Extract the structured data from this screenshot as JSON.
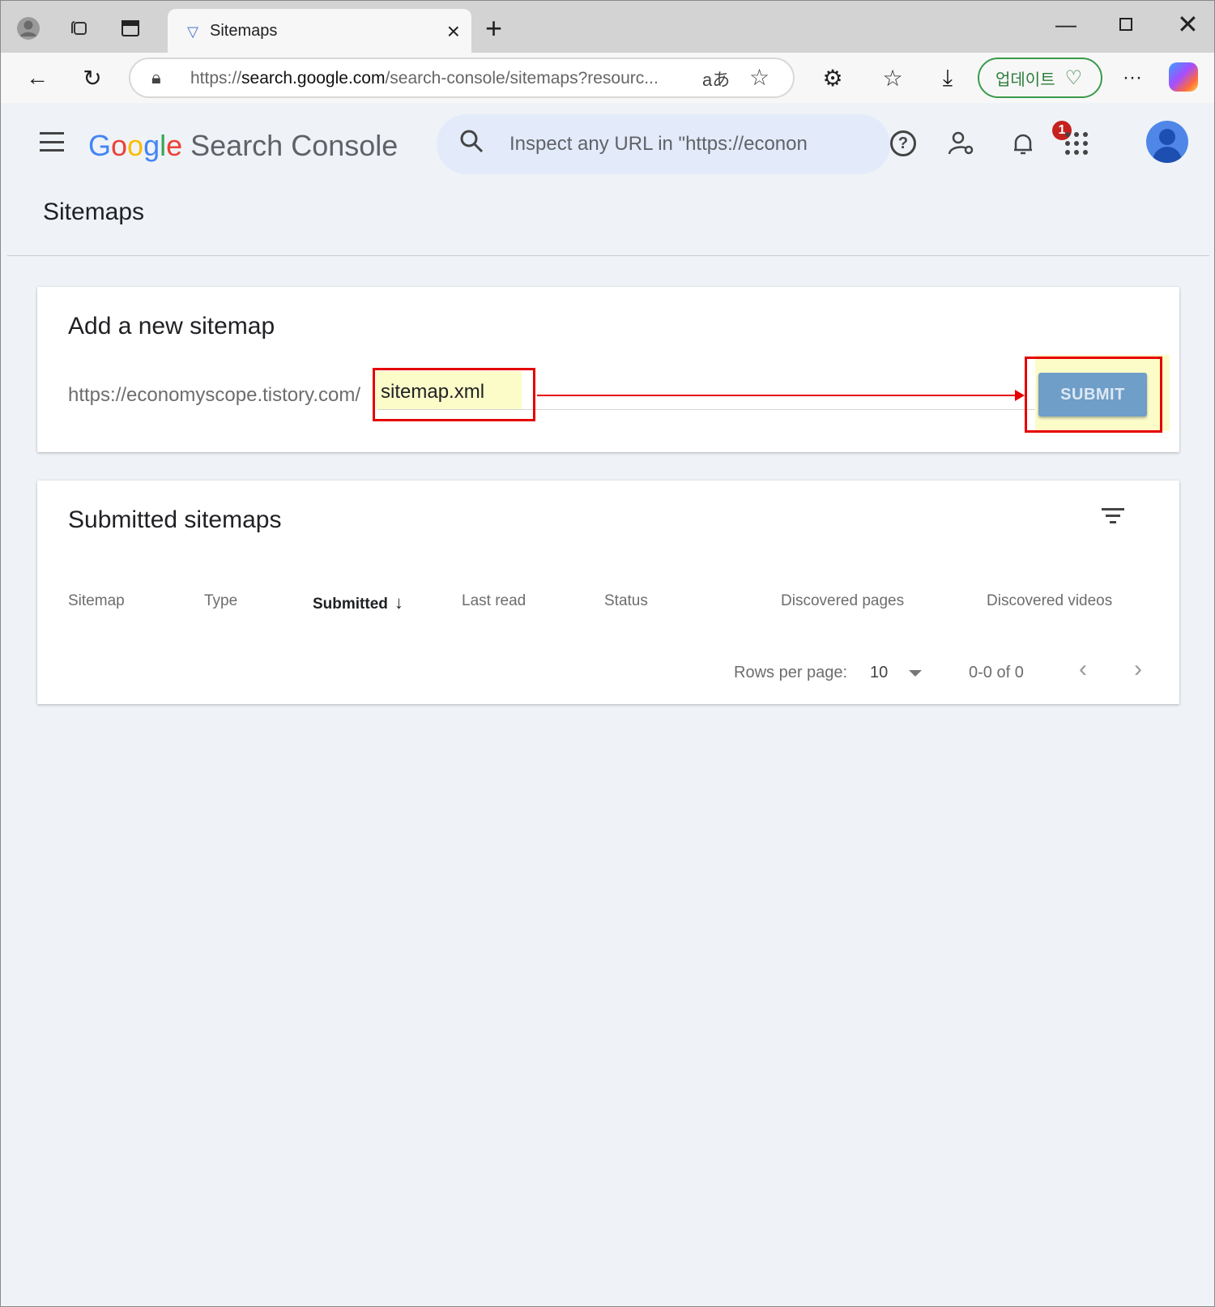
{
  "browser": {
    "tab_title": "Sitemaps",
    "url_scheme": "https://",
    "url_host": "search.google.com",
    "url_path": "/search-console/sitemaps?resourc...",
    "update_label": "업데이트",
    "translate_label": "aあ"
  },
  "app": {
    "logo_letters": [
      "G",
      "o",
      "o",
      "g",
      "l",
      "e"
    ],
    "product_name": "Search Console",
    "search_placeholder": "Inspect any URL in \"https://econon",
    "notification_count": "1",
    "page_title": "Sitemaps"
  },
  "add_sitemap": {
    "title": "Add a new sitemap",
    "url_prefix": "https://economyscope.tistory.com/",
    "input_value": "sitemap.xml",
    "submit_label": "SUBMIT"
  },
  "submitted": {
    "title": "Submitted sitemaps",
    "columns": [
      "Sitemap",
      "Type",
      "Submitted",
      "Last read",
      "Status",
      "Discovered pages",
      "Discovered videos"
    ],
    "sorted_column": "Submitted",
    "rows_per_page_label": "Rows per page:",
    "rows_per_page_value": "10",
    "range_label": "0-0 of 0"
  },
  "icons": {
    "back": "arrow-left-icon",
    "reload": "reload-icon",
    "menu": "hamburger-icon",
    "search": "search-icon",
    "help": "help-icon",
    "admin": "user-settings-icon",
    "notifications": "bell-icon",
    "apps": "apps-grid-icon",
    "filter": "filter-icon"
  },
  "colors": {
    "annotation": "#e60000",
    "highlight": "#fcfcc9",
    "submit_bg": "#6f9ec8",
    "page_bg": "#eff2f7"
  }
}
